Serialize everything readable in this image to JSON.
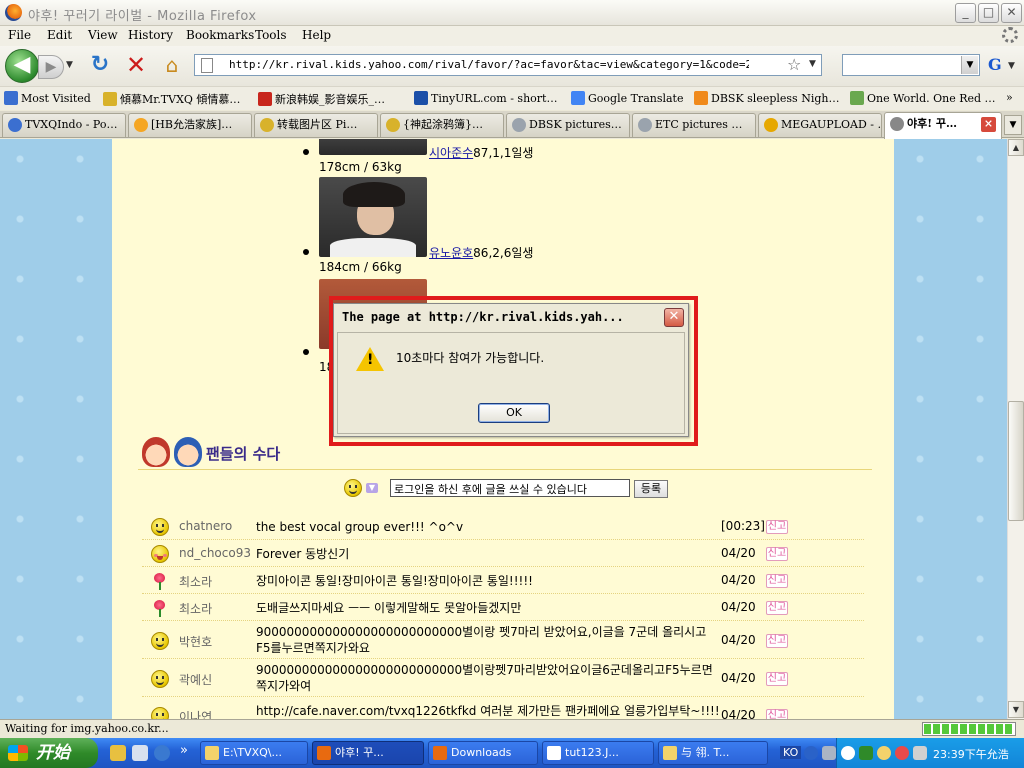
{
  "window": {
    "title": "야후! 꾸러기 라이벌 - Mozilla Firefox",
    "min_label": "_",
    "max_label": "□",
    "close_label": "✕"
  },
  "menu": [
    "File",
    "Edit",
    "View",
    "History",
    "Bookmarks",
    "Tools",
    "Help"
  ],
  "nav": {
    "back_label": "◀",
    "forward_label": "▶",
    "url": "http://kr.rival.kids.yahoo.com/rival/favor/?ac=favor&tac=view&category=1&code=200904&rcd=463",
    "search_value": "",
    "search_engine": "G"
  },
  "bookmarks": [
    {
      "label": "Most Visited",
      "color": "#3b6fd0"
    },
    {
      "label": "傾慕Mr.TVXQ 傾情慕…",
      "color": "#d8b22b"
    },
    {
      "label": "新浪韩娱_影音娱乐_…",
      "color": "#c8261d"
    },
    {
      "label": "TinyURL.com - short…",
      "color": "#1b4fa8"
    },
    {
      "label": "Google Translate",
      "color": "#4285f4"
    },
    {
      "label": "DBSK sleepless Nigh…",
      "color": "#f08a1c"
    },
    {
      "label": "One World. One Red …",
      "color": "#6aa84f"
    }
  ],
  "bookmarks_more": "»",
  "tabs": [
    {
      "label": "TVXQIndo - Po…",
      "color": "#3b6fd0"
    },
    {
      "label": "[HB允浩家族]…",
      "color": "#f5a623"
    },
    {
      "label": "转载图片区 Pi…",
      "color": "#d8b22b"
    },
    {
      "label": "{神起涂鸦簿}…",
      "color": "#d8b22b"
    },
    {
      "label": "DBSK pictures…",
      "color": "#9aa3ad"
    },
    {
      "label": "ETC pictures …",
      "color": "#9aa3ad"
    },
    {
      "label": "MEGAUPLOAD - …",
      "color": "#e6a800"
    },
    {
      "label": "야후! 꾸…",
      "color": "#888888",
      "active": true
    }
  ],
  "members": [
    {
      "name": "시아준수",
      "info": "87,1,1일생",
      "size": "178cm / 63kg"
    },
    {
      "name": "유노윤호",
      "info": "86,2,6일생",
      "size": "184cm / 66kg"
    },
    {
      "name": "",
      "info": "",
      "size": "18"
    }
  ],
  "fans": {
    "title": "팬들의 수다",
    "post_placeholder": "로그인을 하신 후에 글을 쓰실 수 있습니다",
    "submit_label": "등록",
    "report_label": "신고",
    "comments": [
      {
        "icon": "smile",
        "author": "chatnero",
        "text": "the best vocal group ever!!! ^o^v",
        "time": "[00:23]"
      },
      {
        "icon": "blush",
        "author": "nd_choco93",
        "text": "Forever 동방신기",
        "time": "04/20"
      },
      {
        "icon": "rose",
        "author": "최소라",
        "text": "장미아이콘 통일!장미아이콘 통일!장미아이콘 통일!!!!!",
        "time": "04/20"
      },
      {
        "icon": "rose",
        "author": "최소라",
        "text": "도배글쓰지마세요 ㅡㅡ 이렇게말해도 못알아들겠지만",
        "time": "04/20"
      },
      {
        "icon": "smile",
        "author": "박현호",
        "text": "900000000000000000000000000별이랑 펫7마리 받았어요,이글을 7군데 올리시고 F5를누르면쪽지가와요",
        "time": "04/20"
      },
      {
        "icon": "smile",
        "author": "곽예신",
        "text": "900000000000000000000000000별이랑펫7마리받았어요이글6군데올리고F5누르면쪽지가와여",
        "time": "04/20"
      },
      {
        "icon": "smile",
        "author": "이나연",
        "text": "http://cafe.naver.com/tvxq1226tkfkd 여러분 제가만든 팬카페에요 얼릉가입부탁~!!!!",
        "time": "04/20"
      }
    ]
  },
  "dialog": {
    "title": "The page at http://kr.rival.kids.yah...",
    "message": "10초마다 참여가 가능합니다.",
    "ok_label": "OK"
  },
  "status": {
    "text": "Waiting for img.yahoo.co.kr...",
    "progress": 1.0
  },
  "taskbar": {
    "start_label": "开始",
    "more_label": "»",
    "tasks": [
      {
        "label": "E:\\TVXQ\\...",
        "color": "#f3d26b"
      },
      {
        "label": "야후! 꾸...",
        "color": "#e86a10",
        "active": true
      },
      {
        "label": "Downloads",
        "color": "#e86a10"
      },
      {
        "label": "tut123.J...",
        "color": "#ffffff"
      },
      {
        "label": "与 翎. T...",
        "color": "#f3d26b"
      }
    ],
    "lang": "KO",
    "clock": "23:39下午允浩"
  }
}
